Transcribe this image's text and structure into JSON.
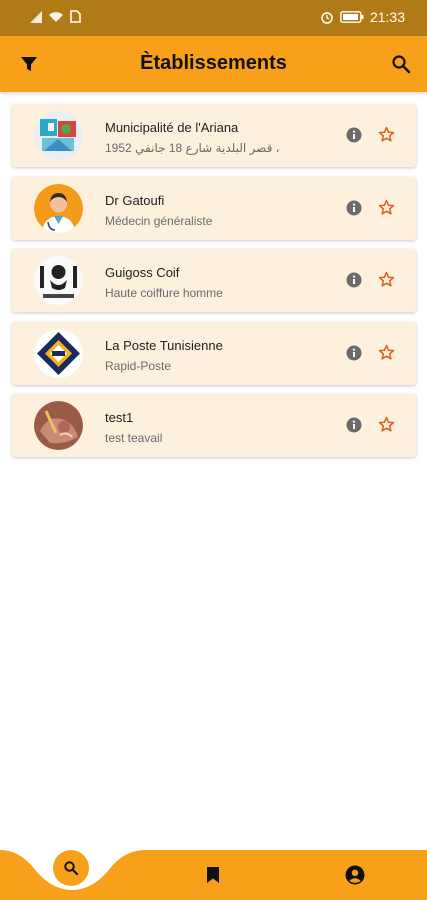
{
  "status_bar": {
    "time": "21:33",
    "battery_icon": "battery-icon",
    "alarm_icon": "alarm-icon"
  },
  "header": {
    "title": "Ètablissements",
    "filter_icon": "filter-icon",
    "search_icon": "search-icon",
    "accent_color": "#f9a01b"
  },
  "establishments": [
    {
      "name": "Municipalité de l'Ariana",
      "subtitle": "قصر البلدية شارع 18 جانفي 1952 ،",
      "avatar": "ariana-logo"
    },
    {
      "name": "Dr Gatoufi",
      "subtitle": "Médecin généraliste",
      "avatar": "doctor-avatar"
    },
    {
      "name": "Guigoss Coif",
      "subtitle": "Haute coiffure homme",
      "avatar": "barber-logo"
    },
    {
      "name": "La Poste Tunisienne",
      "subtitle": "Rapid-Poste",
      "avatar": "poste-logo"
    },
    {
      "name": "test1",
      "subtitle": "test teavail",
      "avatar": "test-image"
    }
  ],
  "bottom_nav": {
    "items": [
      {
        "icon": "search-icon",
        "active": true
      },
      {
        "icon": "bookmark-icon",
        "active": false
      },
      {
        "icon": "account-icon",
        "active": false
      }
    ]
  }
}
